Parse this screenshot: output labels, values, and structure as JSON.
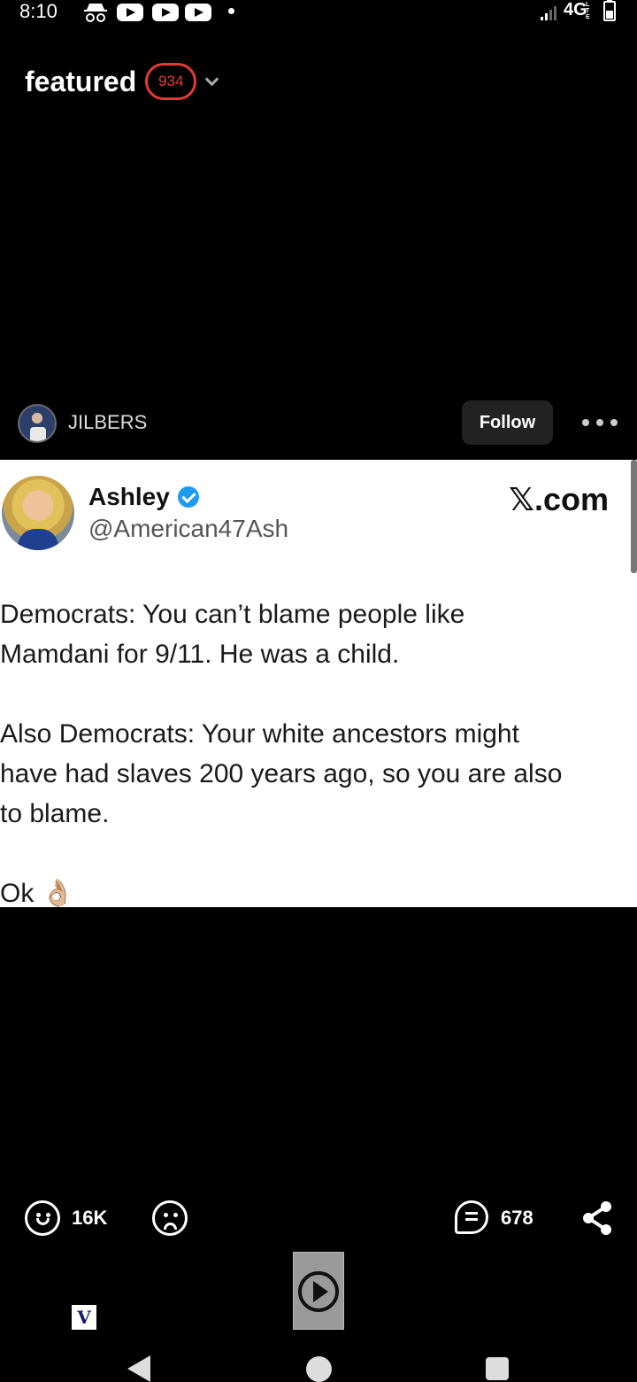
{
  "status_bar": {
    "time": "8:10",
    "icons": [
      "incognito-icon",
      "youtube-icon",
      "youtube-icon",
      "youtube-icon",
      "notification-dot"
    ],
    "network": "4G",
    "network_sub": "LTE",
    "battery_icon": "battery-icon"
  },
  "header": {
    "title": "featured",
    "badge_count": "934",
    "badge_color": "#e53935"
  },
  "post": {
    "author": "JILBERS",
    "follow_label": "Follow"
  },
  "tweet": {
    "name": "Ashley",
    "handle": "@American47Ash",
    "source": "𝕏.com",
    "text": "Democrats: You can’t blame people like\nMamdani for 9/11. He was a child.\n\nAlso Democrats: Your white ancestors might\nhave had slaves 200 years ago, so you are also\nto blame.\n\nOk",
    "emoji": "👌🏼",
    "verified_color": "#1d9bf0"
  },
  "actions": {
    "like_count": "16K",
    "comment_count": "678"
  },
  "mini_logo": "V"
}
